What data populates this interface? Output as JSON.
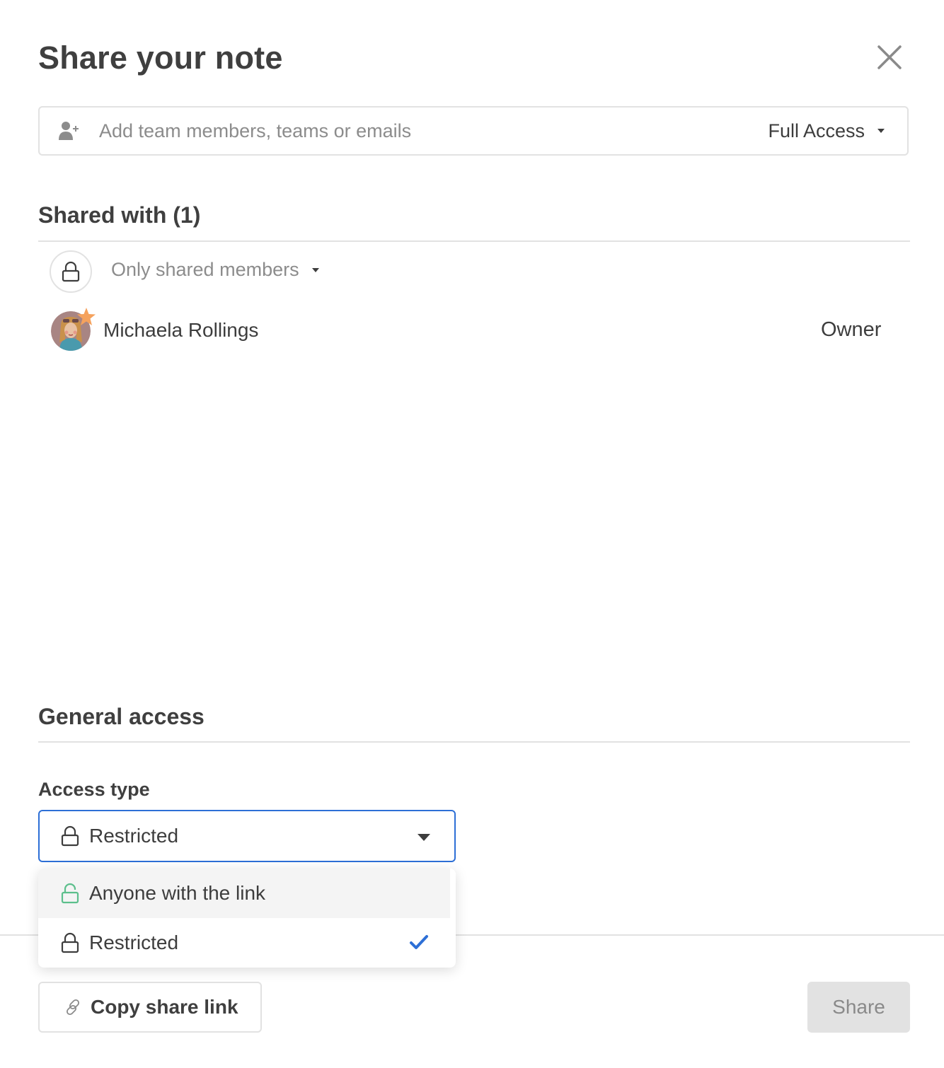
{
  "dialog": {
    "title": "Share your note",
    "close_icon": "close-icon"
  },
  "invite": {
    "icon": "add-person-icon",
    "placeholder": "Add team members, teams or emails",
    "value": "",
    "permission": "Full Access"
  },
  "shared_with": {
    "heading": "Shared with (1)",
    "count": 1,
    "visibility": {
      "icon": "lock-icon",
      "label": "Only shared members"
    },
    "members": [
      {
        "name": "Michaela Rollings",
        "role": "Owner",
        "badge_icon": "star-icon"
      }
    ]
  },
  "general_access": {
    "heading": "General access",
    "access_type_label": "Access type",
    "selected": "Restricted",
    "options": [
      {
        "label": "Anyone with the link",
        "icon": "unlock-icon",
        "selected": false,
        "hovered": true
      },
      {
        "label": "Restricted",
        "icon": "lock-icon",
        "selected": true,
        "hovered": false
      }
    ]
  },
  "footer": {
    "copy_link_label": "Copy share link",
    "share_label": "Share"
  },
  "colors": {
    "accent": "#2d6fd6",
    "unlock_green": "#5cbf8c",
    "star_orange": "#f5a25d",
    "divider": "#e2e2e2",
    "disabled_button": "#e2e2e2"
  }
}
